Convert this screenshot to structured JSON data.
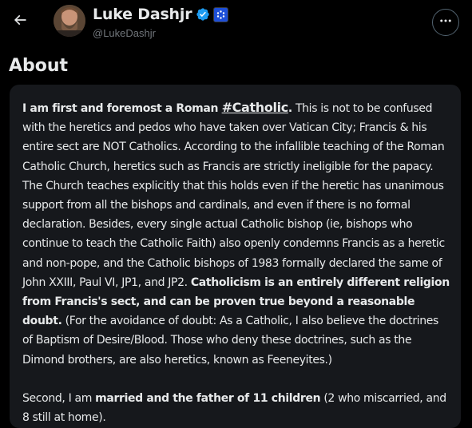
{
  "header": {
    "display_name": "Luke Dashjr",
    "handle": "@LukeDashjr",
    "back_icon": "arrow-left-icon",
    "more_icon": "ellipsis-icon",
    "verified_color": "#1d9bf0",
    "affiliation_badge_color": "#1d4fd8"
  },
  "about": {
    "title": "About",
    "p1_bold_start": "I am first and foremost a Roman ",
    "p1_hashtag": "#Catholic",
    "p1_bold_period": ".",
    "p1_text1": " This is not to be confused with the heretics and pedos who have taken over Vatican City; Francis & his entire sect are NOT Catholics. According to the infallible teaching of the Roman Catholic Church, heretics such as Francis are strictly ineligible for the papacy. The Church teaches explicitly that this holds even if the heretic has unanimous support from all the bishops and cardinals, and even if there is no formal declaration. Besides, every single actual Catholic bishop (ie, bishops who continue to teach the Catholic Faith) also openly condemns Francis as a heretic and non-pope, and the Catholic bishops of 1983 formally declared the same of John XXIII, Paul VI, JP1, and JP2. ",
    "p1_bold2": "Catholicism is an entirely different religion from Francis's sect, and can be proven true beyond a reasonable doubt.",
    "p1_text2": " (For the avoidance of doubt: As a Catholic, I also believe the doctrines of Baptism of Desire/Blood. Those who deny these doctrines, such as the Dimond brothers, are also heretics, known as Feeneyites.)",
    "p2_text1": "Second, I am ",
    "p2_bold": "married and the father of 11 children",
    "p2_text2": " (2 who miscarried, and 8 still at home)."
  }
}
